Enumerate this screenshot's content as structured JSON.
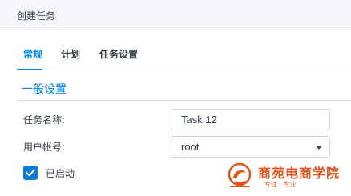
{
  "window": {
    "title": "创建任务"
  },
  "tabs": [
    {
      "label": "常规",
      "active": true
    },
    {
      "label": "计划",
      "active": false
    },
    {
      "label": "任务设置",
      "active": false
    }
  ],
  "section": {
    "title": "一般设置"
  },
  "form": {
    "task_name_label": "任务名称:",
    "task_name_value": "Task 12",
    "user_label": "用户帐号:",
    "user_value": "root",
    "enabled_label": "已启动",
    "enabled_checked": true
  },
  "watermark": {
    "brand": "商苑电商学院",
    "tagline": "专注 · 专业"
  },
  "colors": {
    "accent": "#0086e5",
    "checkbox": "#0a7ed4",
    "watermark": "#e2541b"
  }
}
